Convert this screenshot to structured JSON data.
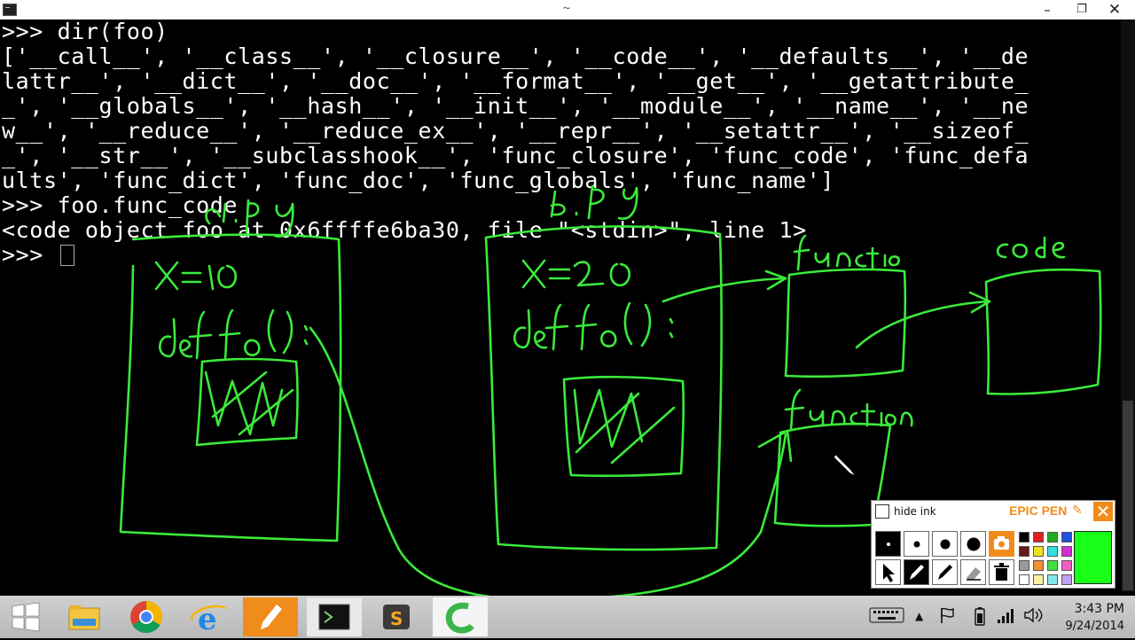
{
  "window": {
    "drag_marker": "~",
    "minimize": "–",
    "maximize": "❐",
    "close": "✕"
  },
  "terminal": {
    "lines": [
      ">>> dir(foo)",
      "['__call__', '__class__', '__closure__', '__code__', '__defaults__', '__de",
      "lattr__', '__dict__', '__doc__', '__format__', '__get__', '__getattribute_",
      "_', '__globals__', '__hash__', '__init__', '__module__', '__name__', '__ne",
      "w__', '__reduce__', '__reduce_ex__', '__repr__', '__setattr__', '__sizeof_",
      "_', '__str__', '__subclasshook__', 'func_closure', 'func_code', 'func_defa",
      "ults', 'func_dict', 'func_doc', 'func_globals', 'func_name']",
      ">>> foo.func_code",
      "<code object foo at 0x6ffffe6ba30, file \"<stdin>\", line 1>",
      ">>> "
    ]
  },
  "epic_pen": {
    "hide_ink_label": "hide ink",
    "brand": "EPIC PEN",
    "close": "✕",
    "selected_color": "#18ff18",
    "palette": [
      "#000000",
      "#e02020",
      "#22aa22",
      "#2050e0",
      "#6a1a1a",
      "#f0e020",
      "#30e0e0",
      "#d030d0",
      "#9a9a9a",
      "#f09030",
      "#40e040",
      "#f060c0",
      "#ffffff",
      "#f8f0a0",
      "#80e8e8",
      "#c0a0f0"
    ]
  },
  "taskbar": {
    "items": [
      "start",
      "file-explorer",
      "chrome",
      "internet-explorer",
      "epic-pen",
      "terminal",
      "sublime-text",
      "camtasia"
    ],
    "clock_time": "3:43 PM",
    "clock_date": "9/24/2014"
  }
}
